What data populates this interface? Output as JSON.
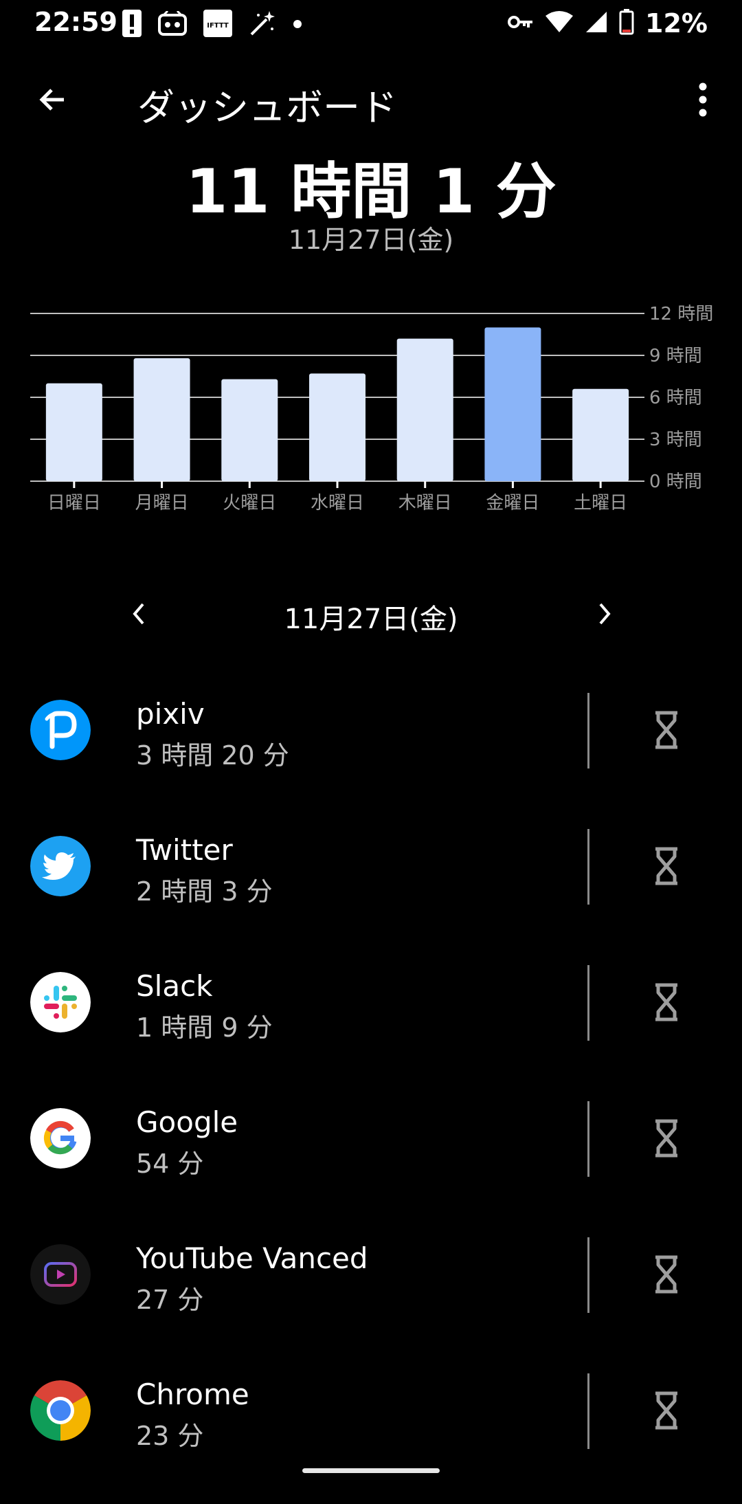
{
  "status_bar": {
    "time": "22:59",
    "battery": "12%",
    "ifttt_label": "IFTTT"
  },
  "app_bar": {
    "title": "ダッシュボード"
  },
  "summary": {
    "total_time": "11 時間 1 分",
    "date": "11月27日(金)"
  },
  "colors": {
    "bar": "#dde8fb",
    "bar_selected": "#8ab4f8",
    "grid": "#ffffff",
    "axis_text": "#9e9e9e"
  },
  "chart_data": {
    "type": "bar",
    "categories": [
      "日曜日",
      "月曜日",
      "火曜日",
      "水曜日",
      "木曜日",
      "金曜日",
      "土曜日"
    ],
    "values": [
      7.0,
      8.8,
      7.3,
      7.7,
      10.2,
      11.0,
      6.6
    ],
    "selected_index": 5,
    "ylim": [
      0,
      12
    ],
    "yticks": [
      0,
      3,
      6,
      9,
      12
    ],
    "ytick_labels": [
      "0 時間",
      "3 時間",
      "6 時間",
      "9 時間",
      "12 時間"
    ],
    "grid": true,
    "title": "",
    "xlabel": "",
    "ylabel": ""
  },
  "date_nav": {
    "date": "11月27日(金)"
  },
  "apps": [
    {
      "name": "pixiv",
      "usage": "3 時間 20 分",
      "icon": "pixiv-icon"
    },
    {
      "name": "Twitter",
      "usage": "2 時間 3 分",
      "icon": "twitter-icon"
    },
    {
      "name": "Slack",
      "usage": "1 時間 9 分",
      "icon": "slack-icon"
    },
    {
      "name": "Google",
      "usage": "54 分",
      "icon": "google-icon"
    },
    {
      "name": "YouTube Vanced",
      "usage": "27 分",
      "icon": "youtube-vanced-icon"
    },
    {
      "name": "Chrome",
      "usage": "23 分",
      "icon": "chrome-icon"
    }
  ]
}
